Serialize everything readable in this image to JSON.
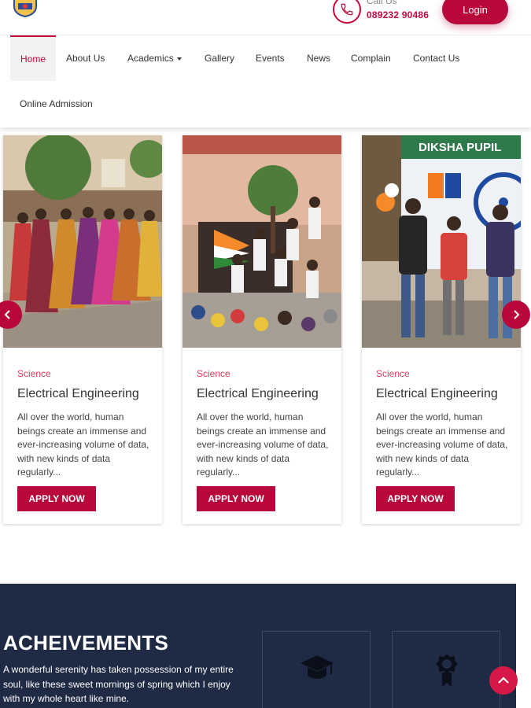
{
  "header": {
    "logo_icon": "school-crest-icon",
    "call_label": "Call Us",
    "call_number": "089232 90486",
    "login_label": "Login"
  },
  "nav": {
    "items": [
      {
        "label": "Home",
        "active": true
      },
      {
        "label": "About Us"
      },
      {
        "label": "Academics",
        "dropdown": true
      },
      {
        "label": "Gallery"
      },
      {
        "label": "Events"
      },
      {
        "label": "News"
      },
      {
        "label": "Complain"
      },
      {
        "label": "Contact Us"
      },
      {
        "label": "Online Admission"
      }
    ]
  },
  "carousel": {
    "cards": [
      {
        "category": "Science",
        "title": "Electrical Engineering",
        "description": "All over the world, human beings create an immense and ever-increasing volume of data, with new kinds of data regularly...",
        "button_label": "APPLY NOW"
      },
      {
        "category": "Science",
        "title": "Electrical Engineering",
        "description": "All over the world, human beings create an immense and ever-increasing volume of data, with new kinds of data regularly...",
        "button_label": "APPLY NOW"
      },
      {
        "category": "Science",
        "title": "Electrical Engineering",
        "description": "All over the world, human beings create an immense and ever-increasing volume of data, with new kinds of data regularly...",
        "button_label": "APPLY NOW"
      }
    ],
    "banner_text": "DIKSHA PUPIL"
  },
  "achievements": {
    "title": "ACHEIVEMENTS",
    "text": "A wonderful serenity has taken possession of my entire soul, like these sweet mornings of spring which I enjoy with my whole heart like mine.",
    "stats": [
      {
        "icon": "graduation-cap-icon"
      },
      {
        "icon": "award-badge-icon"
      }
    ]
  },
  "colors": {
    "accent": "#b8073a",
    "category": "#e23a5b",
    "dark_section": "#1f2a44"
  }
}
